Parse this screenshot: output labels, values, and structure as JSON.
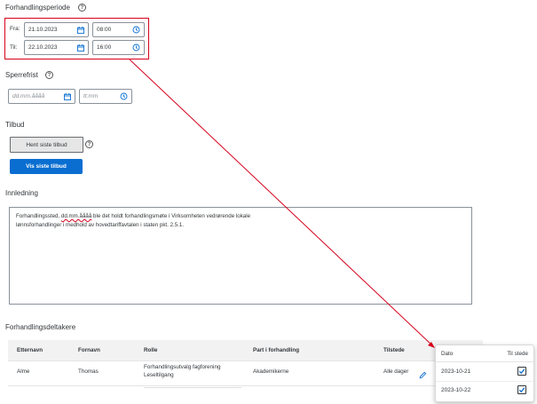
{
  "period": {
    "title": "Forhandlingsperiode",
    "from_label": "Fra:",
    "from_date": "21.10.2023",
    "from_time": "08:00",
    "to_label": "Til:",
    "to_date": "22.10.2023",
    "to_time": "16:00"
  },
  "deadline": {
    "title": "Sperrefrist",
    "date_placeholder": "dd.mm.åååå",
    "time_placeholder": "tt:mm"
  },
  "offer": {
    "title": "Tilbud",
    "fetch_button": "Hent siste tilbud",
    "show_button": "Vis siste tilbud"
  },
  "intro": {
    "title": "Innledning",
    "text_before": "Forhandlingssted, ",
    "text_marked": "dd.mm.åååå",
    "text_after": " ble det holdt forhandlingsmøte i Virksomheten vedrørende lokale",
    "text_line2": "lønnsforhandlinger i medhold av hovedtariffavtalen i staten pkt. 2.5.1."
  },
  "participants": {
    "title": "Forhandlingsdeltakere",
    "columns": [
      "Etternavn",
      "Fornavn",
      "Rolle",
      "Part i forhandling",
      "Tilstede"
    ],
    "rows": [
      {
        "last_name": "Alme",
        "first_name": "Thomas",
        "role_line1": "Forhandlingsutvalg fagforening",
        "role_line2": "Leseltilgang",
        "party": "Akademikerne",
        "present": "Alle dager"
      }
    ]
  },
  "popover": {
    "col_date": "Dato",
    "col_present": "Til stede",
    "rows": [
      {
        "date": "2023-10-21",
        "checked": true
      },
      {
        "date": "2023-10-22",
        "checked": true
      }
    ]
  },
  "colors": {
    "primary": "#0a6ed1",
    "highlight": "#d6001c"
  },
  "icons": [
    "help-icon",
    "calendar-icon",
    "clock-icon",
    "edit-icon",
    "checkmark-icon"
  ]
}
